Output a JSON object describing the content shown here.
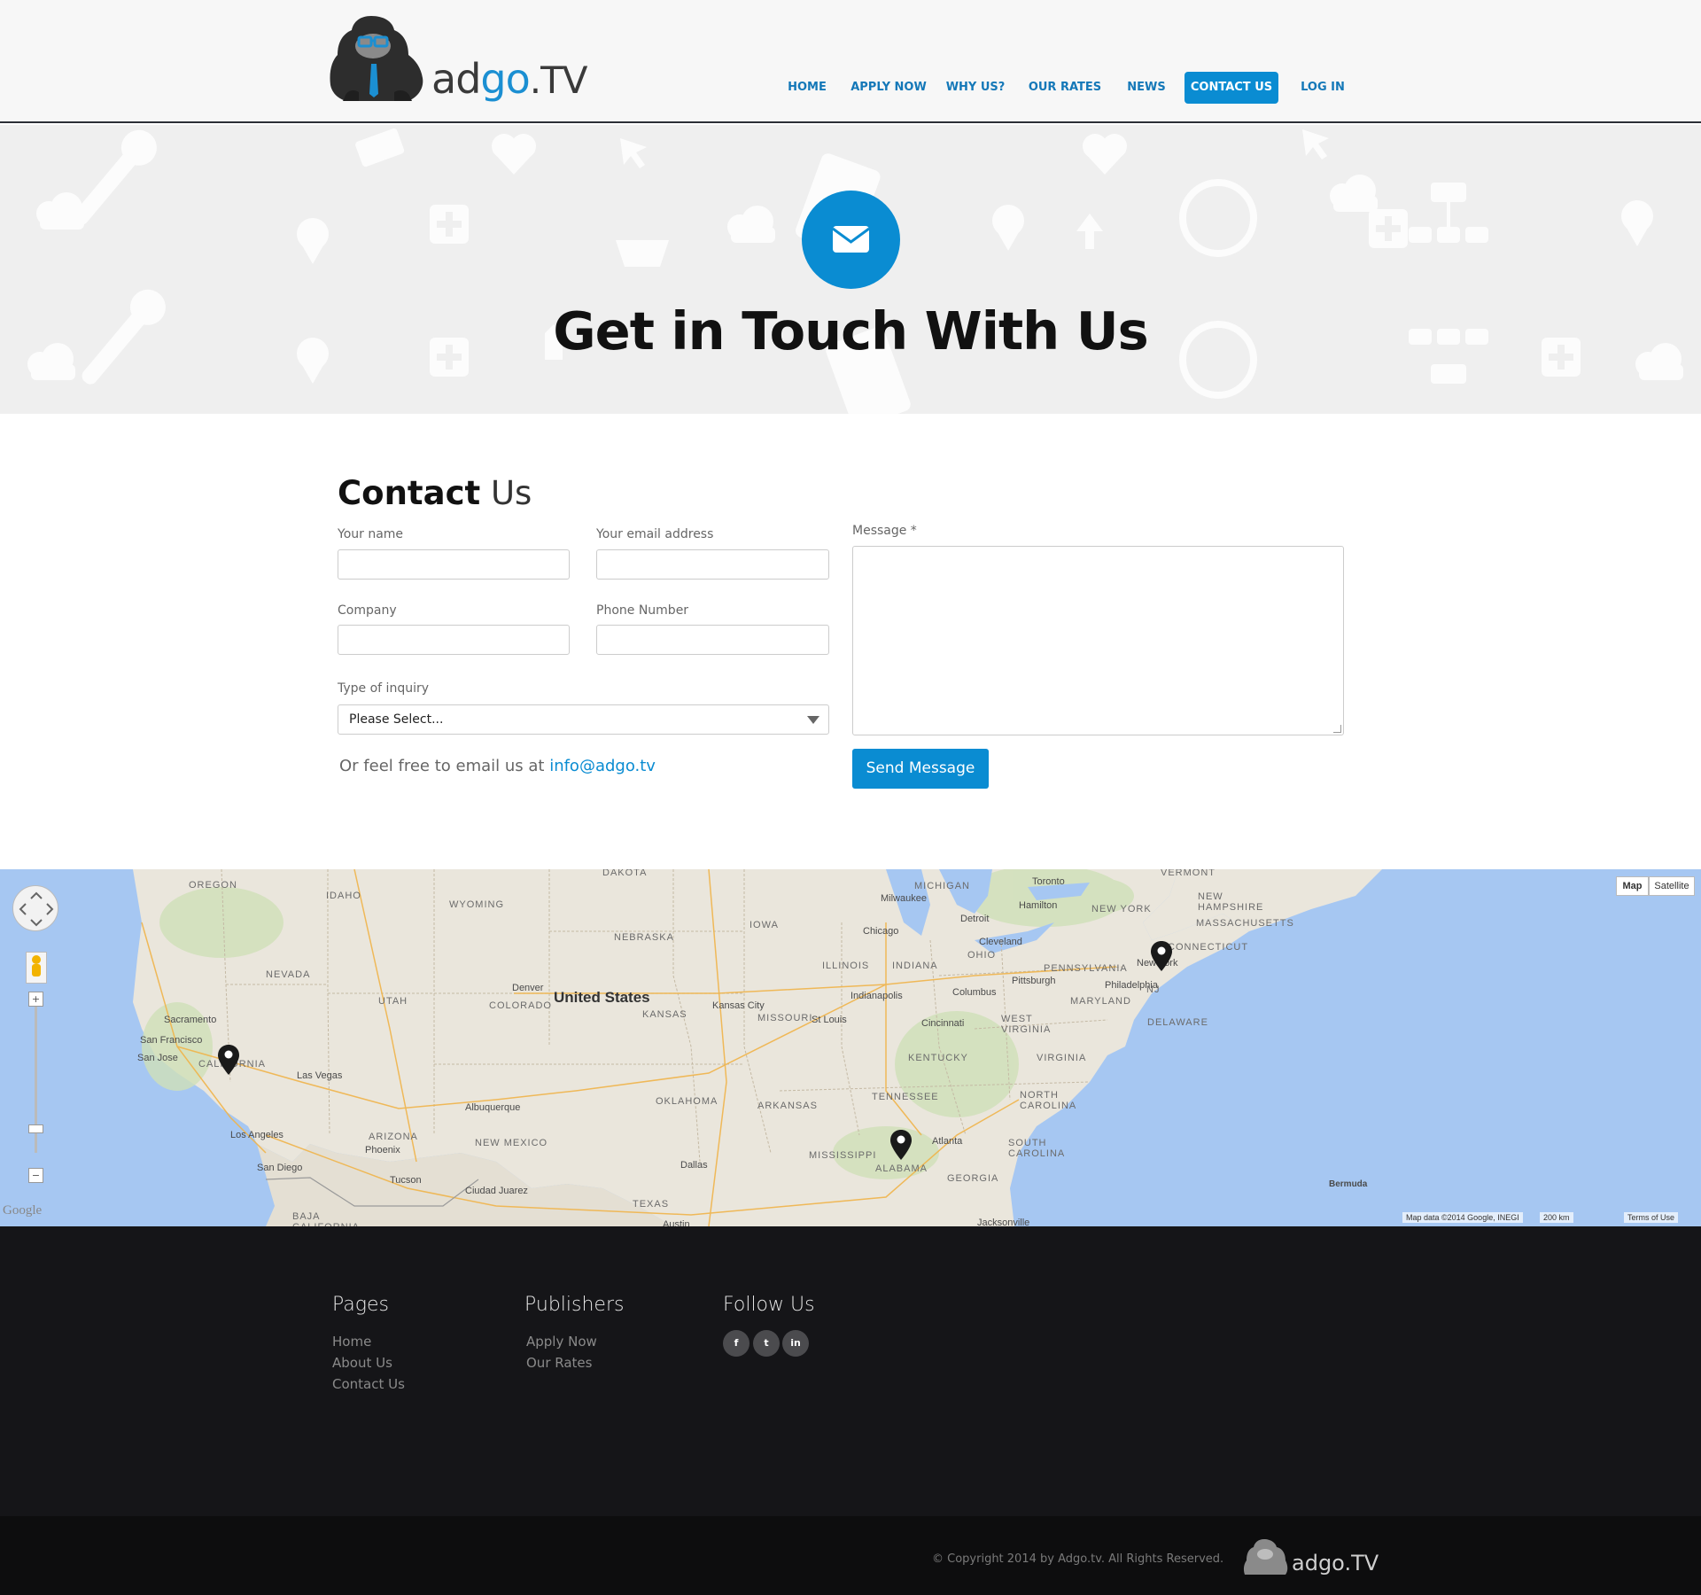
{
  "header": {
    "logo": {
      "text_main": "adgo",
      "text_go": "go",
      "text_ad": "ad",
      "text_tv": ".TV"
    },
    "nav": [
      {
        "label": "HOME"
      },
      {
        "label": "APPLY NOW"
      },
      {
        "label": "WHY US?"
      },
      {
        "label": "OUR RATES"
      },
      {
        "label": "NEWS"
      },
      {
        "label": "CONTACT US",
        "active": true
      },
      {
        "label": "LOG IN"
      }
    ]
  },
  "hero": {
    "icon": "envelope-icon",
    "title": "Get in Touch With Us"
  },
  "contact": {
    "title_bold": "Contact",
    "title_light": " Us",
    "name_label": "Your name",
    "email_label": "Your email address",
    "company_label": "Company",
    "phone_label": "Phone Number",
    "inquiry_label": "Type of inquiry",
    "inquiry_value": "Please Select...",
    "message_label": "Message *",
    "send_label": "Send Message",
    "email_prefix": "Or feel free to email us at ",
    "email_link": "info@adgo.tv"
  },
  "map": {
    "country_label": "United States",
    "map_button": "Map",
    "satellite_button": "Satellite",
    "attribution": "Map data ©2014 Google, INEGI",
    "scale": "200 km",
    "terms": "Terms of Use",
    "google": "Google",
    "zoom_in": "+",
    "zoom_out": "−",
    "states": [
      "DAKOTA",
      "OREGON",
      "IDAHO",
      "WYOMING",
      "NEVADA",
      "UTAH",
      "COLORADO",
      "NEBRASKA",
      "KANSAS",
      "IOWA",
      "MISSOURI",
      "ILLINOIS",
      "INDIANA",
      "OHIO",
      "MICHIGAN",
      "KENTUCKY",
      "TENNESSEE",
      "ARKANSAS",
      "OKLAHOMA",
      "NEW MEXICO",
      "ARIZONA",
      "TEXAS",
      "MISSISSIPPI",
      "ALABAMA",
      "GEORGIA",
      "SOUTH CAROLINA",
      "NORTH CAROLINA",
      "VIRGINIA",
      "WEST VIRGINIA",
      "PENNSYLVANIA",
      "NEW YORK",
      "MARYLAND",
      "DELAWARE",
      "MASSACHUSETTS",
      "NEW HAMPSHIRE",
      "VERMONT",
      "CALIFORNIA",
      "BAJA CALIFORNIA",
      "CONNECTICUT",
      "NJ"
    ],
    "cities": [
      "Milwaukee",
      "Chicago",
      "Detroit",
      "Toronto",
      "Hamilton",
      "Cleveland",
      "Pittsburgh",
      "Columbus",
      "Indianapolis",
      "Cincinnati",
      "Philadelphia",
      "New York",
      "Denver",
      "Kansas City",
      "St Louis",
      "Sacramento",
      "San Francisco",
      "San Jose",
      "Las Vegas",
      "Los Angeles",
      "San Diego",
      "Phoenix",
      "Tucson",
      "Albuquerque",
      "Dallas",
      "Atlanta",
      "Ciudad Juarez",
      "Austin",
      "Jacksonville",
      "Bermuda"
    ]
  },
  "footer": {
    "pages_title": "Pages",
    "pages": [
      "Home",
      "About Us",
      "Contact Us"
    ],
    "publishers_title": "Publishers",
    "publishers": [
      "Apply Now",
      "Our Rates"
    ],
    "follow_title": "Follow Us",
    "social": [
      {
        "label": "f",
        "icon": "facebook-icon"
      },
      {
        "label": "t",
        "icon": "twitter-icon"
      },
      {
        "label": "in",
        "icon": "linkedin-icon"
      }
    ],
    "copyright": "© Copyright 2014 by Adgo.tv.  All Rights Reserved.",
    "small_logo_text": "adgo.TV"
  },
  "colors": {
    "accent": "#0a8cd2",
    "nav_text": "#1478b8",
    "footer_bg": "#151518",
    "bottom_bg": "#0d0d0e",
    "map_water": "#a6c7f2",
    "map_land": "#eae6dc"
  }
}
